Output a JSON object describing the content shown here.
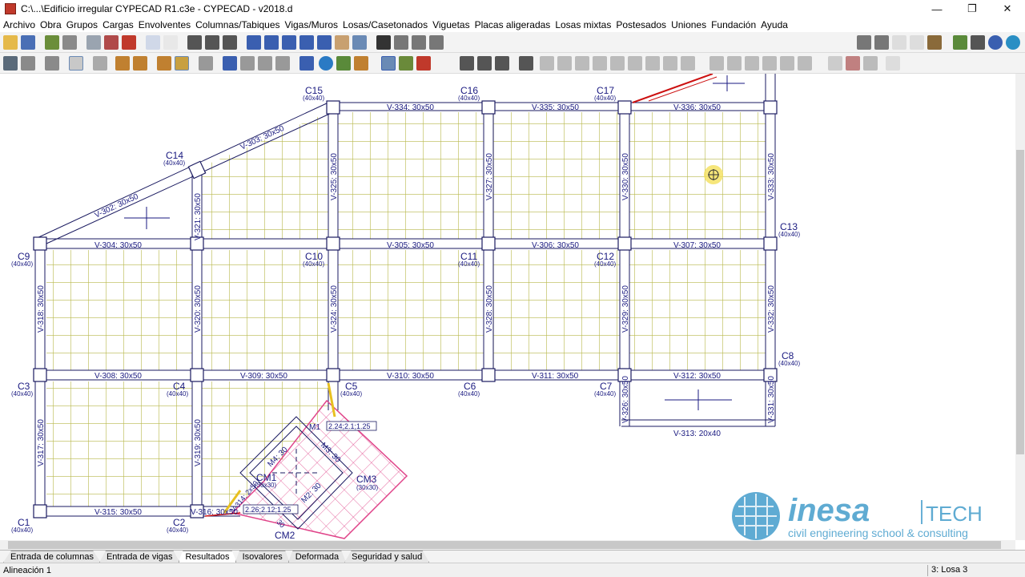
{
  "window": {
    "title": "C:\\...\\Edificio irregular CYPECAD R1.c3e - CYPECAD - v2018.d",
    "controls": [
      "—",
      "❐",
      "✕"
    ]
  },
  "menu": [
    "Archivo",
    "Obra",
    "Grupos",
    "Cargas",
    "Envolventes",
    "Columnas/Tabiques",
    "Vigas/Muros",
    "Losas/Casetonados",
    "Viguetas",
    "Placas aligeradas",
    "Losas mixtas",
    "Postesados",
    "Uniones",
    "Fundación",
    "Ayuda"
  ],
  "columns": [
    {
      "id": "C15",
      "size": "(40x40)"
    },
    {
      "id": "C16",
      "size": "(40x40)"
    },
    {
      "id": "C17",
      "size": "(40x40)"
    },
    {
      "id": "C14",
      "size": "(40x40)"
    },
    {
      "id": "C13",
      "size": "(40x40)"
    },
    {
      "id": "C9",
      "size": "(40x40)"
    },
    {
      "id": "C10",
      "size": "(40x40)"
    },
    {
      "id": "C11",
      "size": "(40x40)"
    },
    {
      "id": "C12",
      "size": "(40x40)"
    },
    {
      "id": "C8",
      "size": "(40x40)"
    },
    {
      "id": "C3",
      "size": "(40x40)"
    },
    {
      "id": "C4",
      "size": "(40x40)"
    },
    {
      "id": "C5",
      "size": "(40x40)"
    },
    {
      "id": "C6",
      "size": "(40x40)"
    },
    {
      "id": "C7",
      "size": "(40x40)"
    },
    {
      "id": "C1",
      "size": "(40x40)"
    },
    {
      "id": "C2",
      "size": "(40x40)"
    },
    {
      "id": "CM1",
      "size": "(30x30)"
    },
    {
      "id": "CM3",
      "size": "(30x30)"
    },
    {
      "id": "CM2",
      "size": ""
    }
  ],
  "beams": {
    "v334": "V-334: 30x50",
    "v335": "V-335: 30x50",
    "v336": "V-336: 30x50",
    "v303": "V-303: 30x50",
    "v302": "V-302: 30x50",
    "v304": "V-304: 30x50",
    "v305": "V-305: 30x50",
    "v306": "V-306: 30x50",
    "v307": "V-307: 30x50",
    "v308": "V-308: 30x50",
    "v309": "V-309: 30x50",
    "v310": "V-310: 30x50",
    "v311": "V-311: 30x50",
    "v312": "V-312: 30x50",
    "v313": "V-313: 20x40",
    "v315": "V-315: 30x50",
    "v316": "V-316: 30x50",
    "v321": "V-321: 30x50",
    "v325": "V-325: 30x50",
    "v327": "V-327: 30x50",
    "v330": "V-330: 30x50",
    "v333": "V-333: 30x50",
    "v318": "V-318: 30x50",
    "v320": "V-320: 30x50",
    "v324": "V-324: 30x50",
    "v328": "V-328: 30x50",
    "v329": "V-329: 30x50",
    "v332": "V-332: 30x50",
    "v317": "V-317: 30x50",
    "v319": "V-319: 30x50",
    "v326": "V-326: 30x50",
    "v331": "V-331: 30x50",
    "v314": "V-314: 2x50"
  },
  "annotations": {
    "m4": "M4: 30",
    "m3": "M3: 30",
    "m2": "M2: 30",
    "m1": "M1",
    "dim1": "2.24;2.1;1.25",
    "dim2": "2.26;2.12;1.25",
    "small30": "30"
  },
  "logo": {
    "brand": "inesa",
    "suffix": "TECH",
    "tagline": "civil engineering school & consulting"
  },
  "tabs": [
    "Entrada de columnas",
    "Entrada de vigas",
    "Resultados",
    "Isovalores",
    "Deformada",
    "Seguridad y salud"
  ],
  "active_tab": "Resultados",
  "status": {
    "left": "Alineación 1",
    "right": "3: Losa 3"
  },
  "colors": {
    "structure": "#1a1a60",
    "mesh": "#b8b84a",
    "label": "#1a1a80",
    "pink": "#e0458a",
    "logo": "#2a8fc4"
  }
}
